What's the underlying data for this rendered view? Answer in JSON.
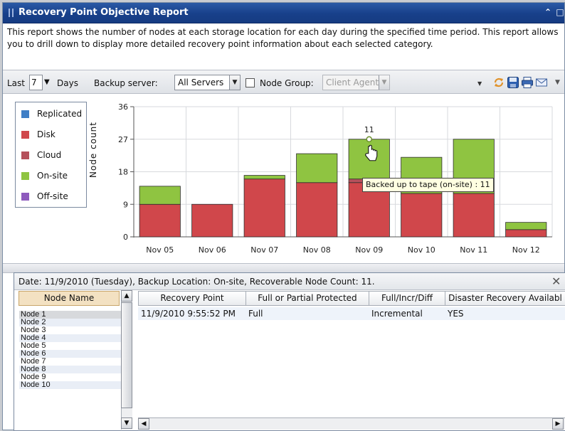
{
  "window": {
    "title": "Recovery Point Objective Report",
    "controls": [
      "collapse-icon",
      "maximize-icon"
    ]
  },
  "description": "This report shows the number of nodes at each storage location for each day during the specified time period. This report allows you to drill down to display more detailed recovery point information about each selected category.",
  "toolbar": {
    "last_label": "Last",
    "days_value": "7",
    "days_label": "Days",
    "backup_server_label": "Backup server:",
    "backup_server_value": "All Servers",
    "node_group_label": "Node Group:",
    "node_group_value": "Client Agent",
    "node_group_checked": false,
    "icons": [
      "refresh-icon",
      "save-icon",
      "print-icon",
      "email-icon"
    ]
  },
  "legend": [
    {
      "label": "Replicated",
      "color": "#3f7fc6"
    },
    {
      "label": "Disk",
      "color": "#d0474b"
    },
    {
      "label": "Cloud",
      "color": "#b5505b"
    },
    {
      "label": "On-site",
      "color": "#8fc441"
    },
    {
      "label": "Off-site",
      "color": "#8e5bbd"
    }
  ],
  "chart_data": {
    "type": "bar",
    "stacked": true,
    "ylabel": "Node count",
    "yticks": [
      0,
      9,
      18,
      27,
      36
    ],
    "ylim": [
      0,
      36
    ],
    "grid": true,
    "categories": [
      "Nov 05",
      "Nov 06",
      "Nov 07",
      "Nov 08",
      "Nov 09",
      "Nov 10",
      "Nov 11",
      "Nov 12"
    ],
    "series": [
      {
        "name": "Disk",
        "color": "#d0474b",
        "values": [
          9,
          9,
          16,
          15,
          15,
          12,
          12,
          2
        ]
      },
      {
        "name": "Cloud",
        "color": "#b5505b",
        "values": [
          0,
          0,
          0,
          0,
          1,
          0,
          0,
          0
        ]
      },
      {
        "name": "On-site",
        "color": "#8fc441",
        "values": [
          5,
          0,
          1,
          8,
          11,
          10,
          15,
          2
        ]
      }
    ],
    "annotation": {
      "category": "Nov 09",
      "text": "11"
    },
    "tooltip": "Backed up to tape (on-site) : 11"
  },
  "detail": {
    "info": "Date: 11/9/2010 (Tuesday),  Backup Location: On-site, Recoverable Node Count: 11.",
    "node_header": "Node Name",
    "nodes": [
      "Node 1",
      "Node 2",
      "Node 3",
      "Node 4",
      "Node 5",
      "Node 6",
      "Node 7",
      "Node 8",
      "Node 9",
      "Node 10"
    ],
    "columns": [
      "Recovery Point",
      "Full or Partial Protected",
      "Full/Incr/Diff",
      "Disaster Recovery Availabl"
    ],
    "rows": [
      [
        "11/9/2010 9:55:52 PM",
        "Full",
        "Incremental",
        "YES"
      ]
    ]
  }
}
